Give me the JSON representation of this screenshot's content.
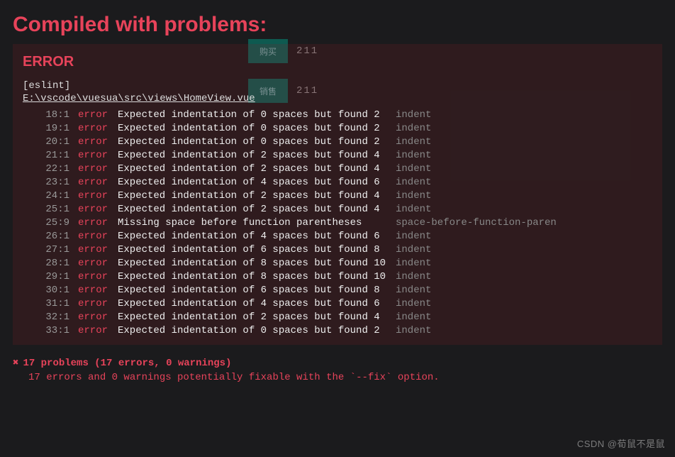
{
  "page_title": "Compiled with problems:",
  "ghost": {
    "rows": [
      {
        "label": "购买",
        "value": "211"
      },
      {
        "label": "销售",
        "value": "211"
      }
    ]
  },
  "error": {
    "heading": "ERROR",
    "tool_tag": "[eslint]",
    "file_path": "E:\\vscode\\vuesua\\src\\views\\HomeView.vue",
    "rows": [
      {
        "loc": "18:1",
        "sev": "error",
        "msg": "Expected indentation of 0 spaces but found 2",
        "rule": "indent"
      },
      {
        "loc": "19:1",
        "sev": "error",
        "msg": "Expected indentation of 0 spaces but found 2",
        "rule": "indent"
      },
      {
        "loc": "20:1",
        "sev": "error",
        "msg": "Expected indentation of 0 spaces but found 2",
        "rule": "indent"
      },
      {
        "loc": "21:1",
        "sev": "error",
        "msg": "Expected indentation of 2 spaces but found 4",
        "rule": "indent"
      },
      {
        "loc": "22:1",
        "sev": "error",
        "msg": "Expected indentation of 2 spaces but found 4",
        "rule": "indent"
      },
      {
        "loc": "23:1",
        "sev": "error",
        "msg": "Expected indentation of 4 spaces but found 6",
        "rule": "indent"
      },
      {
        "loc": "24:1",
        "sev": "error",
        "msg": "Expected indentation of 2 spaces but found 4",
        "rule": "indent"
      },
      {
        "loc": "25:1",
        "sev": "error",
        "msg": "Expected indentation of 2 spaces but found 4",
        "rule": "indent"
      },
      {
        "loc": "25:9",
        "sev": "error",
        "msg": "Missing space before function parentheses",
        "rule": "space-before-function-paren"
      },
      {
        "loc": "26:1",
        "sev": "error",
        "msg": "Expected indentation of 4 spaces but found 6",
        "rule": "indent"
      },
      {
        "loc": "27:1",
        "sev": "error",
        "msg": "Expected indentation of 6 spaces but found 8",
        "rule": "indent"
      },
      {
        "loc": "28:1",
        "sev": "error",
        "msg": "Expected indentation of 8 spaces but found 10",
        "rule": "indent"
      },
      {
        "loc": "29:1",
        "sev": "error",
        "msg": "Expected indentation of 8 spaces but found 10",
        "rule": "indent"
      },
      {
        "loc": "30:1",
        "sev": "error",
        "msg": "Expected indentation of 6 spaces but found 8",
        "rule": "indent"
      },
      {
        "loc": "31:1",
        "sev": "error",
        "msg": "Expected indentation of 4 spaces but found 6",
        "rule": "indent"
      },
      {
        "loc": "32:1",
        "sev": "error",
        "msg": "Expected indentation of 2 spaces but found 4",
        "rule": "indent"
      },
      {
        "loc": "33:1",
        "sev": "error",
        "msg": "Expected indentation of 0 spaces but found 2",
        "rule": "indent"
      }
    ]
  },
  "summary": {
    "cross": "✖",
    "line1": "17 problems (17 errors, 0 warnings)",
    "line2": "17 errors and 0 warnings potentially fixable with the `--fix` option."
  },
  "watermark": "CSDN @荀鼠不是鼠"
}
